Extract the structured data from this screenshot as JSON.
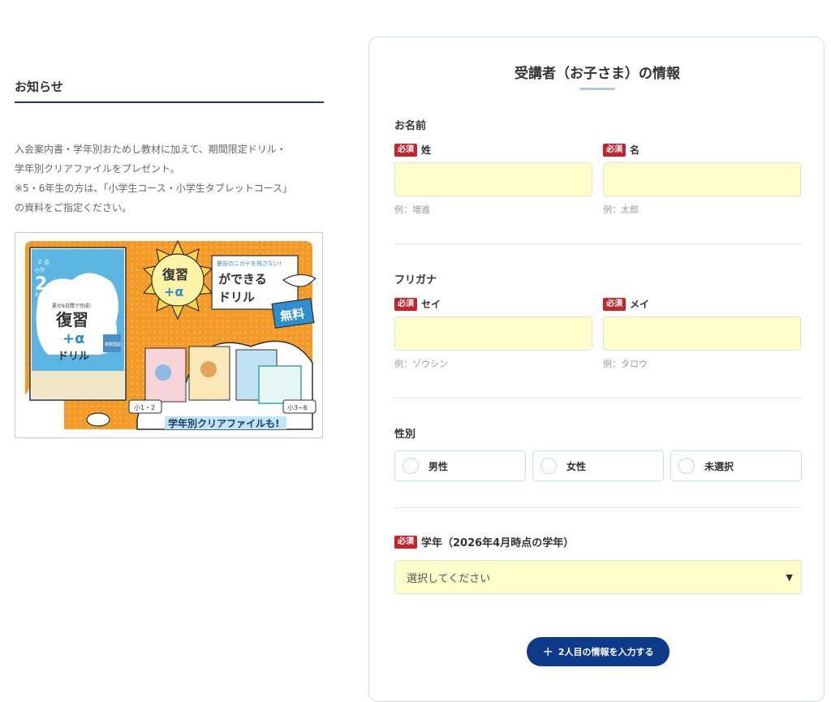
{
  "notice": {
    "heading": "お知らせ",
    "lines": [
      "入会案内書・学年別おためし教材に加えて、期間限定ドリル・",
      "学年別クリアファイルをプレゼント。",
      "※5・6年生の方は、「小学生コース・小学生タブレットコース」",
      "の資料をご指定ください。"
    ]
  },
  "banner": {
    "book_brand": "Z 会",
    "book_grade_prefix": "小学",
    "book_grade": "2",
    "book_grade_suffix": "年生",
    "book_tagline": "夏の9日間で完成!",
    "book_title_1": "復習",
    "book_title_2": "+α",
    "book_title_3": "ドリル",
    "book_badge": "算数国語",
    "sun_title": "復習",
    "sun_alpha": "+α",
    "catch_small": "夏前のニガテを残さない!",
    "catch_main_1": "ができる",
    "catch_main_2": "ドリル",
    "free_label": "無料",
    "grade_tag_low": "小1・2",
    "grade_tag_high": "小3~6",
    "clearfile_caption": "学年別クリアファイルも!"
  },
  "form": {
    "title": "受講者（お子さま）の情報",
    "name_section": "お名前",
    "required_badge": "必須",
    "last_name_label": "姓",
    "first_name_label": "名",
    "last_name_value": "",
    "first_name_value": "",
    "last_name_hint": "例：増進",
    "first_name_hint": "例：太郎",
    "kana_section": "フリガナ",
    "last_kana_label": "セイ",
    "first_kana_label": "メイ",
    "last_kana_value": "",
    "first_kana_value": "",
    "last_kana_hint": "例：ゾウシン",
    "first_kana_hint": "例：タロウ",
    "gender_section": "性別",
    "gender_options": [
      "男性",
      "女性",
      "未選択"
    ],
    "grade_label": "学年（2026年4月時点の学年）",
    "grade_select_value": "選択してください",
    "add_button_plus": "+",
    "add_button_label": "2人目の情報を入力する"
  },
  "colors": {
    "accent_navy": "#0d3b8a",
    "required_red": "#c5242b",
    "input_fill": "#fffdca",
    "banner_orange": "#f39a27",
    "banner_blue": "#3aa6dd"
  }
}
